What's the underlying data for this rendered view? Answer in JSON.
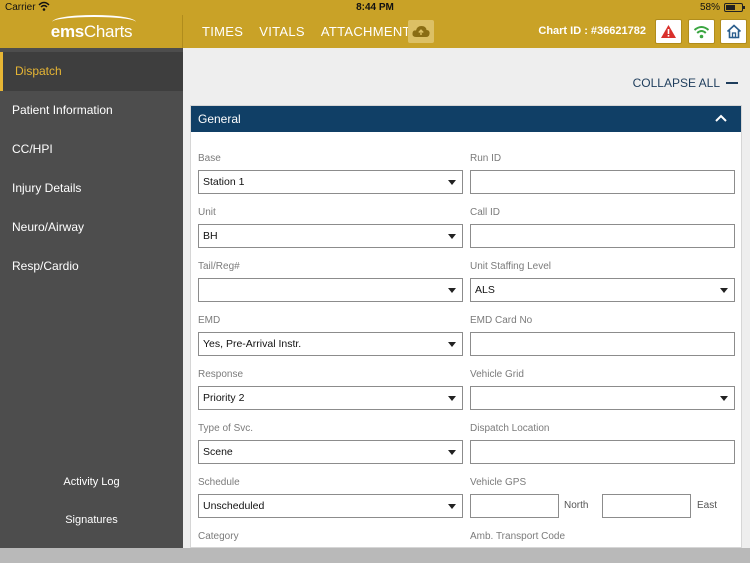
{
  "status": {
    "carrier": "Carrier",
    "time": "8:44 PM",
    "battery": "58%"
  },
  "logo": {
    "brand_a": "ems",
    "brand_b": "Charts"
  },
  "nav": {
    "tabs": [
      "TIMES",
      "VITALS",
      "ATTACHMENTS"
    ],
    "chart_id": "Chart ID : #36621782"
  },
  "sidebar": {
    "items": [
      "Dispatch",
      "Patient Information",
      "CC/HPI",
      "Injury Details",
      "Neuro/Airway",
      "Resp/Cardio"
    ],
    "activity_log": "Activity Log",
    "signatures": "Signatures"
  },
  "main": {
    "collapse_all": "COLLAPSE ALL",
    "panel_title": "General"
  },
  "form": {
    "base_label": "Base",
    "base_value": "Station 1",
    "run_id_label": "Run ID",
    "run_id_value": "",
    "unit_label": "Unit",
    "unit_value": "BH",
    "call_id_label": "Call ID",
    "call_id_value": "",
    "tail_label": "Tail/Reg#",
    "tail_value": "",
    "staffing_label": "Unit Staffing Level",
    "staffing_value": "ALS",
    "emd_label": "EMD",
    "emd_value": "Yes, Pre-Arrival Instr.",
    "emd_card_label": "EMD Card No",
    "emd_card_value": "",
    "response_label": "Response",
    "response_value": "Priority 2",
    "vehicle_grid_label": "Vehicle Grid",
    "vehicle_grid_value": "",
    "type_label": "Type of Svc.",
    "type_value": "Scene",
    "dispatch_loc_label": "Dispatch Location",
    "dispatch_loc_value": "",
    "schedule_label": "Schedule",
    "schedule_value": "Unscheduled",
    "gps_label": "Vehicle GPS",
    "gps_north": "North",
    "gps_east": "East",
    "category_label": "Category",
    "amb_label": "Amb. Transport Code"
  },
  "colors": {
    "gold": "#c9a227",
    "navy": "#103f66",
    "sidebar": "#4d4d4d",
    "active": "#e6b534",
    "warning": "#d9302c",
    "wifi": "#3aa541",
    "home": "#2a5d8c"
  }
}
